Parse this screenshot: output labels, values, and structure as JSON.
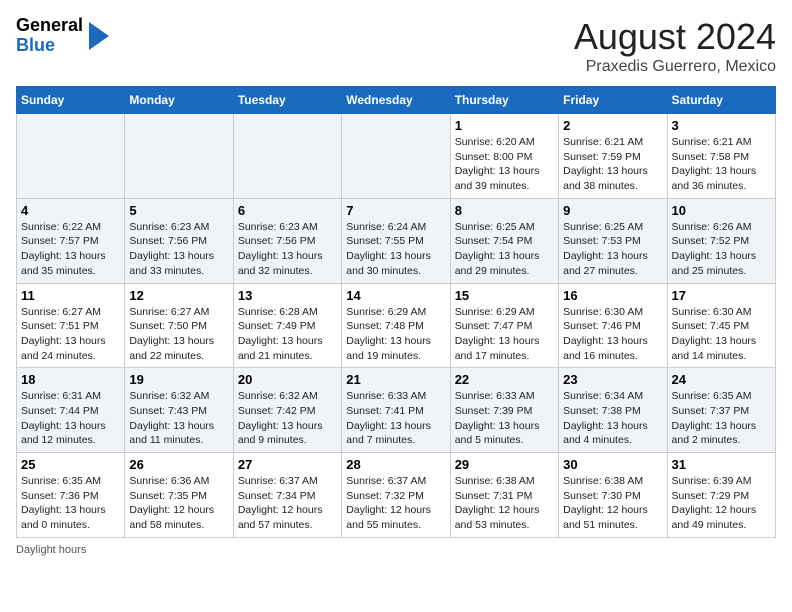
{
  "header": {
    "logo_line1": "General",
    "logo_line2": "Blue",
    "title": "August 2024",
    "subtitle": "Praxedis Guerrero, Mexico"
  },
  "days_of_week": [
    "Sunday",
    "Monday",
    "Tuesday",
    "Wednesday",
    "Thursday",
    "Friday",
    "Saturday"
  ],
  "weeks": [
    [
      {
        "num": "",
        "info": "",
        "empty": true
      },
      {
        "num": "",
        "info": "",
        "empty": true
      },
      {
        "num": "",
        "info": "",
        "empty": true
      },
      {
        "num": "",
        "info": "",
        "empty": true
      },
      {
        "num": "1",
        "info": "Sunrise: 6:20 AM\nSunset: 8:00 PM\nDaylight: 13 hours and 39 minutes.",
        "empty": false
      },
      {
        "num": "2",
        "info": "Sunrise: 6:21 AM\nSunset: 7:59 PM\nDaylight: 13 hours and 38 minutes.",
        "empty": false
      },
      {
        "num": "3",
        "info": "Sunrise: 6:21 AM\nSunset: 7:58 PM\nDaylight: 13 hours and 36 minutes.",
        "empty": false
      }
    ],
    [
      {
        "num": "4",
        "info": "Sunrise: 6:22 AM\nSunset: 7:57 PM\nDaylight: 13 hours and 35 minutes.",
        "empty": false
      },
      {
        "num": "5",
        "info": "Sunrise: 6:23 AM\nSunset: 7:56 PM\nDaylight: 13 hours and 33 minutes.",
        "empty": false
      },
      {
        "num": "6",
        "info": "Sunrise: 6:23 AM\nSunset: 7:56 PM\nDaylight: 13 hours and 32 minutes.",
        "empty": false
      },
      {
        "num": "7",
        "info": "Sunrise: 6:24 AM\nSunset: 7:55 PM\nDaylight: 13 hours and 30 minutes.",
        "empty": false
      },
      {
        "num": "8",
        "info": "Sunrise: 6:25 AM\nSunset: 7:54 PM\nDaylight: 13 hours and 29 minutes.",
        "empty": false
      },
      {
        "num": "9",
        "info": "Sunrise: 6:25 AM\nSunset: 7:53 PM\nDaylight: 13 hours and 27 minutes.",
        "empty": false
      },
      {
        "num": "10",
        "info": "Sunrise: 6:26 AM\nSunset: 7:52 PM\nDaylight: 13 hours and 25 minutes.",
        "empty": false
      }
    ],
    [
      {
        "num": "11",
        "info": "Sunrise: 6:27 AM\nSunset: 7:51 PM\nDaylight: 13 hours and 24 minutes.",
        "empty": false
      },
      {
        "num": "12",
        "info": "Sunrise: 6:27 AM\nSunset: 7:50 PM\nDaylight: 13 hours and 22 minutes.",
        "empty": false
      },
      {
        "num": "13",
        "info": "Sunrise: 6:28 AM\nSunset: 7:49 PM\nDaylight: 13 hours and 21 minutes.",
        "empty": false
      },
      {
        "num": "14",
        "info": "Sunrise: 6:29 AM\nSunset: 7:48 PM\nDaylight: 13 hours and 19 minutes.",
        "empty": false
      },
      {
        "num": "15",
        "info": "Sunrise: 6:29 AM\nSunset: 7:47 PM\nDaylight: 13 hours and 17 minutes.",
        "empty": false
      },
      {
        "num": "16",
        "info": "Sunrise: 6:30 AM\nSunset: 7:46 PM\nDaylight: 13 hours and 16 minutes.",
        "empty": false
      },
      {
        "num": "17",
        "info": "Sunrise: 6:30 AM\nSunset: 7:45 PM\nDaylight: 13 hours and 14 minutes.",
        "empty": false
      }
    ],
    [
      {
        "num": "18",
        "info": "Sunrise: 6:31 AM\nSunset: 7:44 PM\nDaylight: 13 hours and 12 minutes.",
        "empty": false
      },
      {
        "num": "19",
        "info": "Sunrise: 6:32 AM\nSunset: 7:43 PM\nDaylight: 13 hours and 11 minutes.",
        "empty": false
      },
      {
        "num": "20",
        "info": "Sunrise: 6:32 AM\nSunset: 7:42 PM\nDaylight: 13 hours and 9 minutes.",
        "empty": false
      },
      {
        "num": "21",
        "info": "Sunrise: 6:33 AM\nSunset: 7:41 PM\nDaylight: 13 hours and 7 minutes.",
        "empty": false
      },
      {
        "num": "22",
        "info": "Sunrise: 6:33 AM\nSunset: 7:39 PM\nDaylight: 13 hours and 5 minutes.",
        "empty": false
      },
      {
        "num": "23",
        "info": "Sunrise: 6:34 AM\nSunset: 7:38 PM\nDaylight: 13 hours and 4 minutes.",
        "empty": false
      },
      {
        "num": "24",
        "info": "Sunrise: 6:35 AM\nSunset: 7:37 PM\nDaylight: 13 hours and 2 minutes.",
        "empty": false
      }
    ],
    [
      {
        "num": "25",
        "info": "Sunrise: 6:35 AM\nSunset: 7:36 PM\nDaylight: 13 hours and 0 minutes.",
        "empty": false
      },
      {
        "num": "26",
        "info": "Sunrise: 6:36 AM\nSunset: 7:35 PM\nDaylight: 12 hours and 58 minutes.",
        "empty": false
      },
      {
        "num": "27",
        "info": "Sunrise: 6:37 AM\nSunset: 7:34 PM\nDaylight: 12 hours and 57 minutes.",
        "empty": false
      },
      {
        "num": "28",
        "info": "Sunrise: 6:37 AM\nSunset: 7:32 PM\nDaylight: 12 hours and 55 minutes.",
        "empty": false
      },
      {
        "num": "29",
        "info": "Sunrise: 6:38 AM\nSunset: 7:31 PM\nDaylight: 12 hours and 53 minutes.",
        "empty": false
      },
      {
        "num": "30",
        "info": "Sunrise: 6:38 AM\nSunset: 7:30 PM\nDaylight: 12 hours and 51 minutes.",
        "empty": false
      },
      {
        "num": "31",
        "info": "Sunrise: 6:39 AM\nSunset: 7:29 PM\nDaylight: 12 hours and 49 minutes.",
        "empty": false
      }
    ]
  ],
  "footer": "Daylight hours"
}
